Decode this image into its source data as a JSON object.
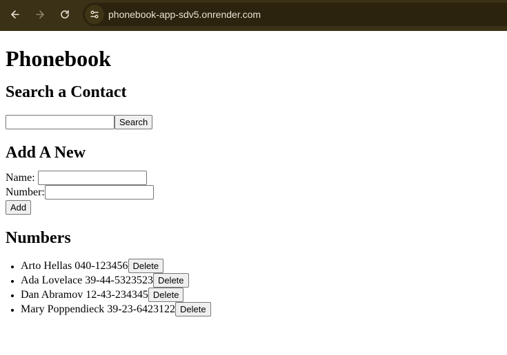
{
  "browser": {
    "url": "phonebook-app-sdv5.onrender.com"
  },
  "page": {
    "title": "Phonebook",
    "search": {
      "heading": "Search a Contact",
      "input_value": "",
      "button_label": "Search"
    },
    "add": {
      "heading": "Add A New",
      "name_label": "Name:",
      "name_value": "",
      "number_label": "Number:",
      "number_value": "",
      "button_label": "Add"
    },
    "numbers": {
      "heading": "Numbers",
      "delete_label": "Delete",
      "entries": [
        "Arto Hellas 040-123456",
        "Ada Lovelace 39-44-5323523",
        "Dan Abramov 12-43-234345",
        "Mary Poppendieck 39-23-6423122"
      ]
    }
  }
}
